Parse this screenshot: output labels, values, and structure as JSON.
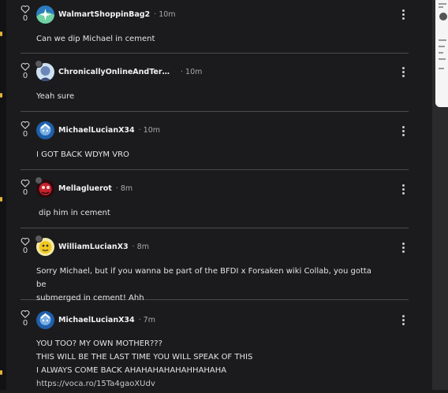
{
  "comments": [
    {
      "user": "WalmartShoppinBag2",
      "time": "10m",
      "likes": "0",
      "lines": [
        "Can we dip Michael in cement"
      ]
    },
    {
      "user": "ChronicallyOnlineAndTermin…",
      "time": "10m",
      "likes": "0",
      "lines": [
        "Yeah sure"
      ]
    },
    {
      "user": "MichaelLucianX34",
      "time": "10m",
      "likes": "0",
      "lines": [
        "I GOT BACK WDYM VRO"
      ]
    },
    {
      "user": "Mellagluerot",
      "time": "8m",
      "likes": "0",
      "lines": [
        "dip him in cement"
      ]
    },
    {
      "user": "WilliamLucianX3",
      "time": "8m",
      "likes": "0",
      "lines": [
        "Sorry Michael, but if you wanna be part of the BFDI x Forsaken wiki Collab, you gotta be",
        "submerged in cement! Ahh"
      ]
    },
    {
      "user": "MichaelLucianX34",
      "time": "7m",
      "likes": "0",
      "lines": [
        "YOU TOO? MY OWN MOTHER???",
        "THIS WILL BE THE LAST TIME YOU WILL SPEAK OF THIS",
        "I ALWAYS COME BACK AHAHAHAHAHAHHAHAHA"
      ],
      "link": "https://voca.ro/15Ta4gaoXUdv"
    }
  ],
  "separator": "·",
  "colors": {
    "background": "#1b1b1d",
    "divider": "#4a4a4d",
    "text": "#e4e4e4",
    "muted": "#a8a8a8"
  },
  "icons": {
    "like": "heart-outline-icon",
    "menu": "kebab-menu-icon",
    "avatar_badge": "profile-badge-icon"
  }
}
